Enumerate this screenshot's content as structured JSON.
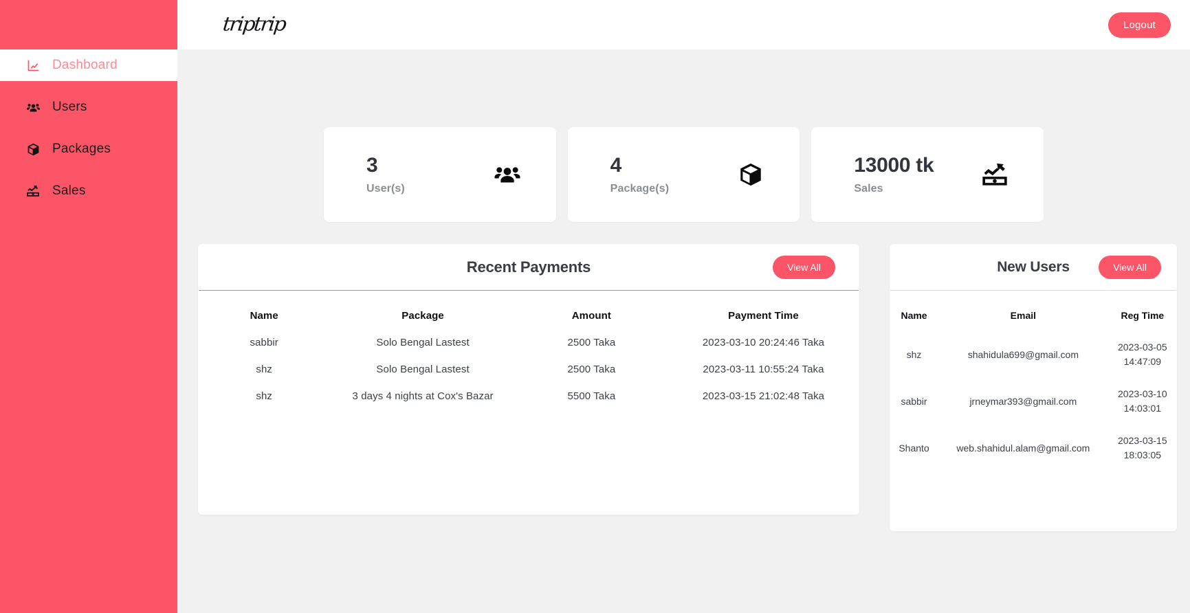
{
  "sidebar": {
    "items": [
      {
        "label": "Dashboard",
        "icon": "chart-line-icon",
        "active": true
      },
      {
        "label": "Users",
        "icon": "users-icon",
        "active": false
      },
      {
        "label": "Packages",
        "icon": "box-icon",
        "active": false
      },
      {
        "label": "Sales",
        "icon": "money-chart-icon",
        "active": false
      }
    ]
  },
  "topbar": {
    "logo_text": "triptrip",
    "logout_label": "Logout"
  },
  "stats": [
    {
      "value": "3",
      "label": "User(s)",
      "icon": "users-icon"
    },
    {
      "value": "4",
      "label": "Package(s)",
      "icon": "box-icon"
    },
    {
      "value": "13000 tk",
      "label": "Sales",
      "icon": "money-chart-icon"
    }
  ],
  "payments_panel": {
    "title": "Recent Payments",
    "view_all_label": "View All",
    "columns": [
      "Name",
      "Package",
      "Amount",
      "Payment Time"
    ],
    "rows": [
      {
        "name": "sabbir",
        "package": "Solo Bengal Lastest",
        "amount": "2500 Taka",
        "time": "2023-03-10 20:24:46 Taka"
      },
      {
        "name": "shz",
        "package": "Solo Bengal Lastest",
        "amount": "2500 Taka",
        "time": "2023-03-11 10:55:24 Taka"
      },
      {
        "name": "shz",
        "package": "3 days 4 nights at Cox's Bazar",
        "amount": "5500 Taka",
        "time": "2023-03-15 21:02:48 Taka"
      }
    ]
  },
  "users_panel": {
    "title": "New Users",
    "view_all_label": "View All",
    "columns": [
      "Name",
      "Email",
      "Reg Time"
    ],
    "rows": [
      {
        "name": "shz",
        "email": "shahidula699@gmail.com",
        "reg_date": "2023-03-05",
        "reg_time": "14:47:09"
      },
      {
        "name": "sabbir",
        "email": "jrneymar393@gmail.com",
        "reg_date": "2023-03-10",
        "reg_time": "14:03:01"
      },
      {
        "name": "Shanto",
        "email": "web.shahidul.alam@gmail.com",
        "reg_date": "2023-03-15",
        "reg_time": "18:03:05"
      }
    ]
  },
  "colors": {
    "brand": "#fb5567",
    "page_bg": "#f1f1f1",
    "panel_bg": "#ffffff",
    "active_nav_text": "#fb8b96",
    "heading_text": "#3a3d44",
    "muted_text": "#8a8d93"
  }
}
